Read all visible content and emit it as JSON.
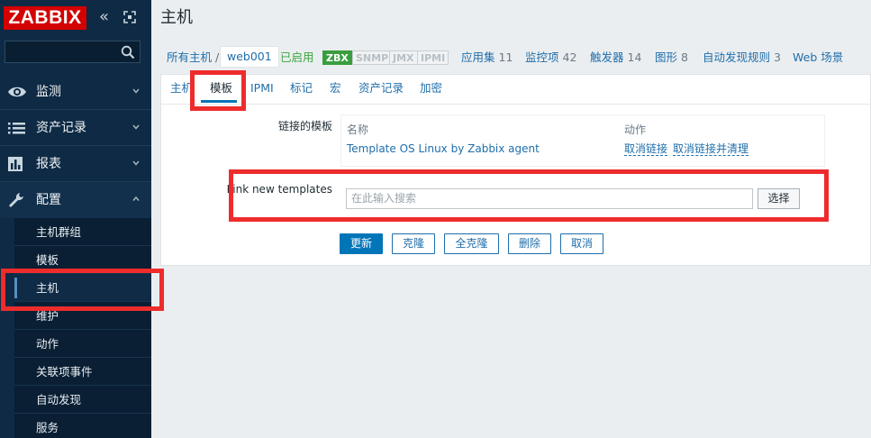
{
  "app": {
    "logo": "ZABBIX"
  },
  "sidebar": {
    "search_placeholder": "",
    "nav": [
      {
        "label": "监测",
        "icon": "eye-icon"
      },
      {
        "label": "资产记录",
        "icon": "list-icon"
      },
      {
        "label": "报表",
        "icon": "bar-chart-icon"
      },
      {
        "label": "配置",
        "icon": "wrench-icon"
      }
    ],
    "sub_items": [
      "主机群组",
      "模板",
      "主机",
      "维护",
      "动作",
      "关联项事件",
      "自动发现",
      "服务"
    ],
    "selected_sub": "主机"
  },
  "page": {
    "title": "主机"
  },
  "host_nav": {
    "all_hosts": "所有主机",
    "separator": "/",
    "current_host": "web001",
    "status": "已启用",
    "availability": [
      "ZBX",
      "SNMP",
      "JMX",
      "IPMI"
    ],
    "links": [
      {
        "label": "应用集",
        "count": "11"
      },
      {
        "label": "监控项",
        "count": "42"
      },
      {
        "label": "触发器",
        "count": "14"
      },
      {
        "label": "图形",
        "count": "8"
      },
      {
        "label": "自动发现规则",
        "count": "3"
      },
      {
        "label": "Web 场景",
        "count": ""
      }
    ]
  },
  "tabs": [
    "主机",
    "模板",
    "IPMI",
    "标记",
    "宏",
    "资产记录",
    "加密"
  ],
  "active_tab": "模板",
  "form": {
    "linked_label": "链接的模板",
    "col_name": "名称",
    "col_action": "动作",
    "linked_template": "Template OS Linux by Zabbix agent",
    "unlink": "取消链接",
    "unlink_clear": "取消链接并清理",
    "new_label": "Link new templates",
    "search_placeholder": "在此输入搜索",
    "select_btn": "选择"
  },
  "buttons": [
    "更新",
    "克隆",
    "全克隆",
    "删除",
    "取消"
  ],
  "colors": {
    "brand": "#d40000",
    "sidebar": "#0f2a44",
    "primary": "#0275b8",
    "link": "#1f6eab",
    "enabled": "#3aa63f",
    "highlight": "#ee2c2c"
  }
}
